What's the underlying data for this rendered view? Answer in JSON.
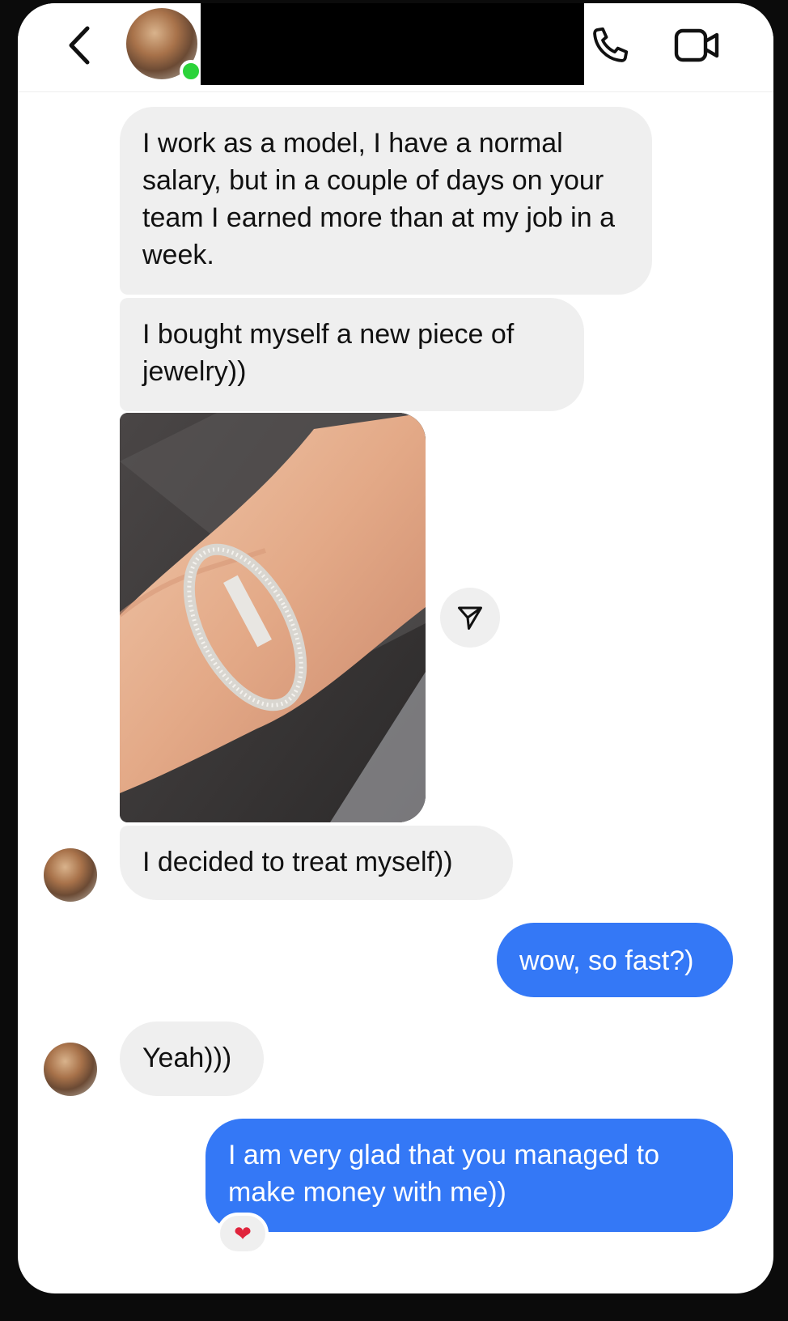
{
  "header": {
    "back_icon": "chevron-left-icon",
    "call_icon": "phone-icon",
    "video_icon": "video-camera-icon",
    "online_color": "#2bd33a"
  },
  "messages": [
    {
      "from": "them",
      "text": "I work as a model, I have a normal salary, but in a couple of days on your team I earned more than at my job in a week."
    },
    {
      "from": "them",
      "text": "I bought myself a new piece of jewelry))"
    },
    {
      "from": "them",
      "type": "photo",
      "share_icon": "send-icon"
    },
    {
      "from": "them",
      "text": "I decided to treat myself))"
    },
    {
      "from": "me",
      "text": "wow, so fast?)"
    },
    {
      "from": "them",
      "text": "Yeah)))"
    },
    {
      "from": "me",
      "text": "I am very glad that you managed to make money with me))",
      "reaction": "❤"
    }
  ],
  "colors": {
    "outgoing_bubble": "#3478f6",
    "incoming_bubble": "#efefef"
  }
}
